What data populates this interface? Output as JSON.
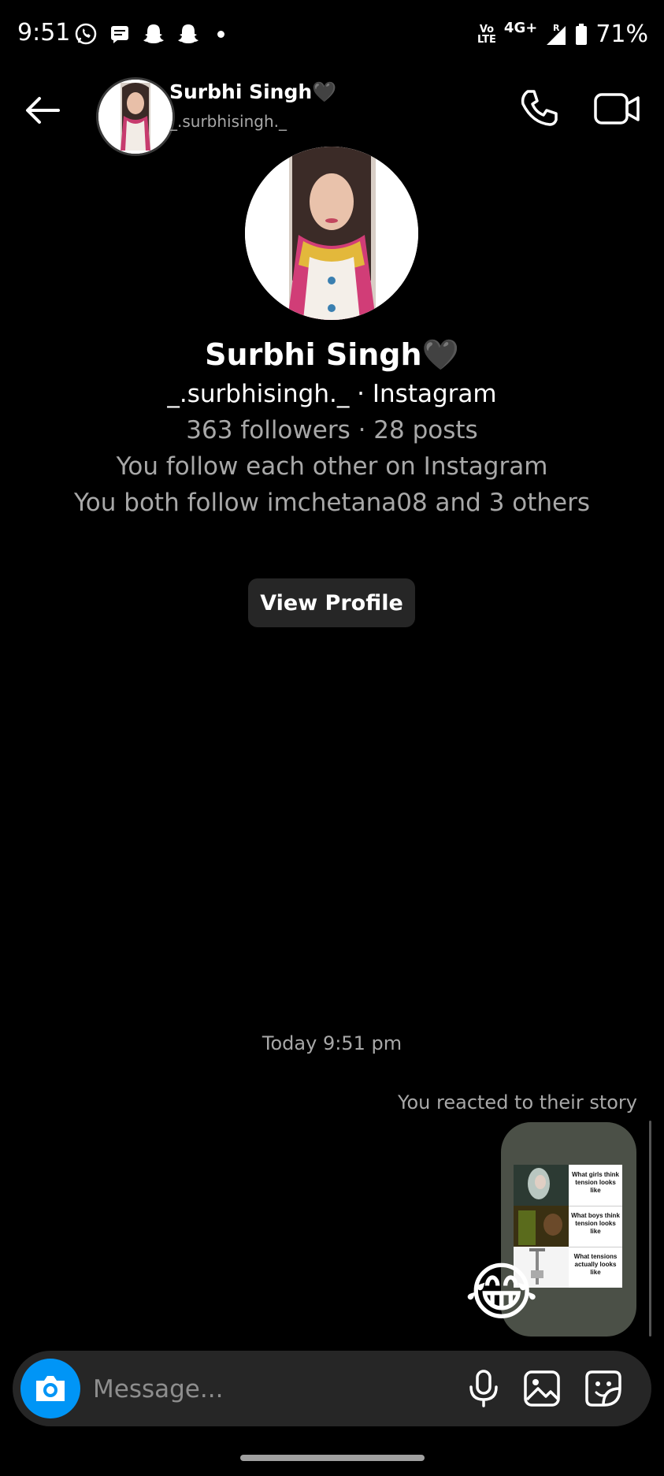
{
  "status_bar": {
    "time": "9:51",
    "network_top": "Vo",
    "network_bottom": "LTE",
    "network_type": "4G+",
    "roaming": "R",
    "battery": "71%"
  },
  "header": {
    "name": "Surbhi Singh🖤",
    "username": "_.surbhisingh._"
  },
  "profile": {
    "name": "Surbhi Singh🖤",
    "handle_line": "_.surbhisingh._ · Instagram",
    "stats_line": "363 followers · 28 posts",
    "mutual_line": "You follow each other on Instagram",
    "common_line": "You both follow imchetana08 and 3 others",
    "view_profile_label": "View Profile"
  },
  "chat": {
    "timestamp": "Today 9:51 pm",
    "reacted_label": "You reacted to their story",
    "story": {
      "rows": [
        "What girls think tension looks like",
        "What boys think tension looks like",
        "What tensions actually looks like"
      ],
      "reaction": "😂"
    }
  },
  "composer": {
    "placeholder": "Message..."
  },
  "colors": {
    "background": "#000000",
    "accent_blue": "#0095f6",
    "secondary_text": "#a8a8a8",
    "button_bg": "#262626"
  },
  "icons": [
    "back-arrow-icon",
    "phone-icon",
    "video-icon",
    "camera-icon",
    "mic-icon",
    "gallery-icon",
    "sticker-icon"
  ]
}
